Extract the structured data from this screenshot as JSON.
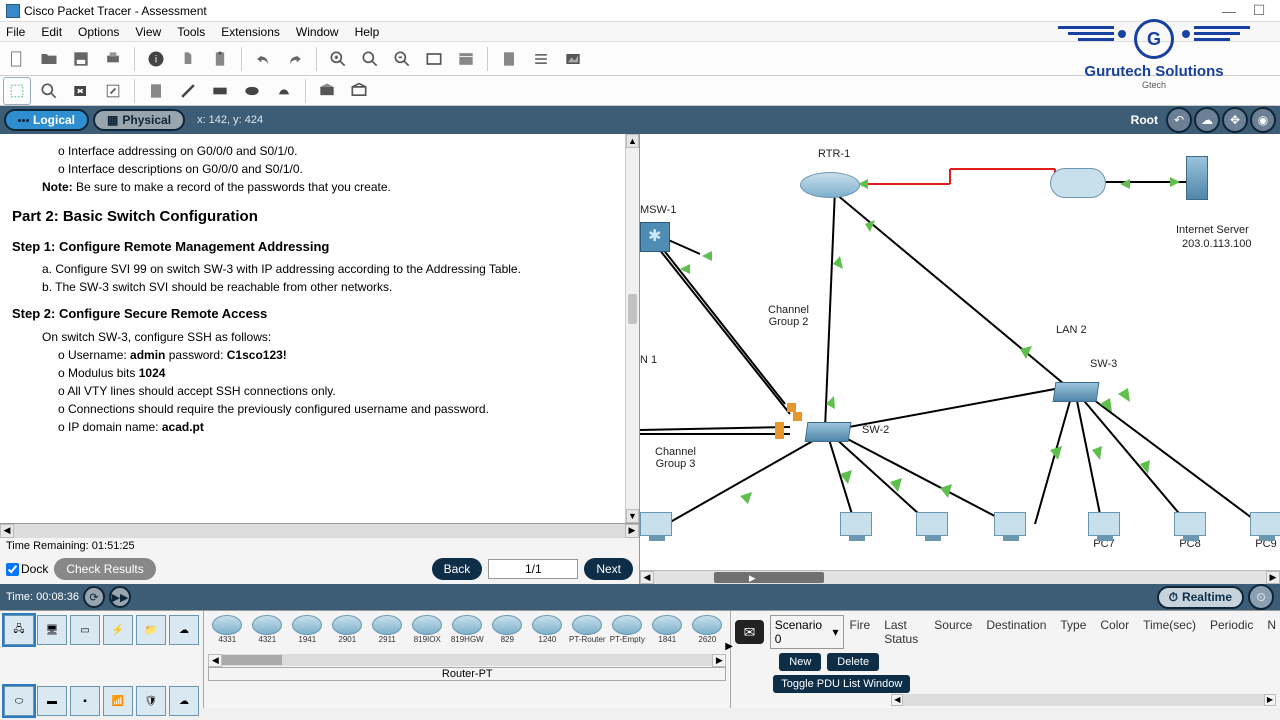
{
  "titlebar": {
    "title": "Cisco Packet Tracer - Assessment"
  },
  "menu": [
    "File",
    "Edit",
    "Options",
    "View",
    "Tools",
    "Extensions",
    "Window",
    "Help"
  ],
  "viewrow": {
    "logical": "Logical",
    "physical": "Physical",
    "coords": "x: 142, y: 424",
    "root": "Root"
  },
  "instructions": {
    "li1": "Interface addressing on G0/0/0 and S0/1/0.",
    "li2": "Interface descriptions on G0/0/0 and S0/1/0.",
    "noteLabel": "Note:",
    "note": " Be sure to make a record of the passwords that you create.",
    "part2": "Part 2: Basic Switch Configuration",
    "step1": "Step 1: Configure Remote Management Addressing",
    "s1a": "Configure SVI 99 on switch SW-3 with IP addressing according to the Addressing Table.",
    "s1b": "The SW-3 switch SVI should be reachable from other networks.",
    "step2": "Step 2: Configure Secure Remote Access",
    "s2intro": "On switch SW-3, configure SSH as follows:",
    "s2l1a": "Username: ",
    "s2l1b": "admin",
    "s2l1c": " password: ",
    "s2l1d": "C1sco123!",
    "s2l2a": "Modulus bits ",
    "s2l2b": "1024",
    "s2l3": "All VTY lines should accept SSH connections only.",
    "s2l4": "Connections should require the previously configured username and password.",
    "s2l5a": "IP domain name: ",
    "s2l5b": "acad.pt"
  },
  "assess": {
    "timeRemain": "Time Remaining: 01:51:25",
    "dock": "Dock",
    "check": "Check Results",
    "back": "Back",
    "page": "1/1",
    "next": "Next"
  },
  "timerow": {
    "time": "Time: 00:08:36",
    "realtime": "Realtime"
  },
  "topo": {
    "rtr1": "RTR-1",
    "msw1": "MSW-1",
    "n1": "N 1",
    "cg2": "Channel\nGroup 2",
    "cg3": "Channel\nGroup 3",
    "sw2": "SW-2",
    "sw3": "SW-3",
    "lan2": "LAN 2",
    "iserver1": "Internet Server",
    "iserver2": "203.0.113.100",
    "pc7": "PC7",
    "pc8": "PC8",
    "pc9": "PC9"
  },
  "palette": {
    "routers": [
      "4331",
      "4321",
      "1941",
      "2901",
      "2911",
      "819IOX",
      "819HGW",
      "829",
      "1240",
      "PT-Router",
      "PT-Empty",
      "1841",
      "2620"
    ],
    "label": "Router-PT"
  },
  "pdu": {
    "scenario": "Scenario 0",
    "new": "New",
    "delete": "Delete",
    "toggle": "Toggle PDU List Window",
    "cols": [
      "Fire",
      "Last Status",
      "Source",
      "Destination",
      "Type",
      "Color",
      "Time(sec)",
      "Periodic",
      "N"
    ]
  },
  "logo": {
    "name": "Gurutech Solutions",
    "sub": "Gtech",
    "g": "G"
  }
}
